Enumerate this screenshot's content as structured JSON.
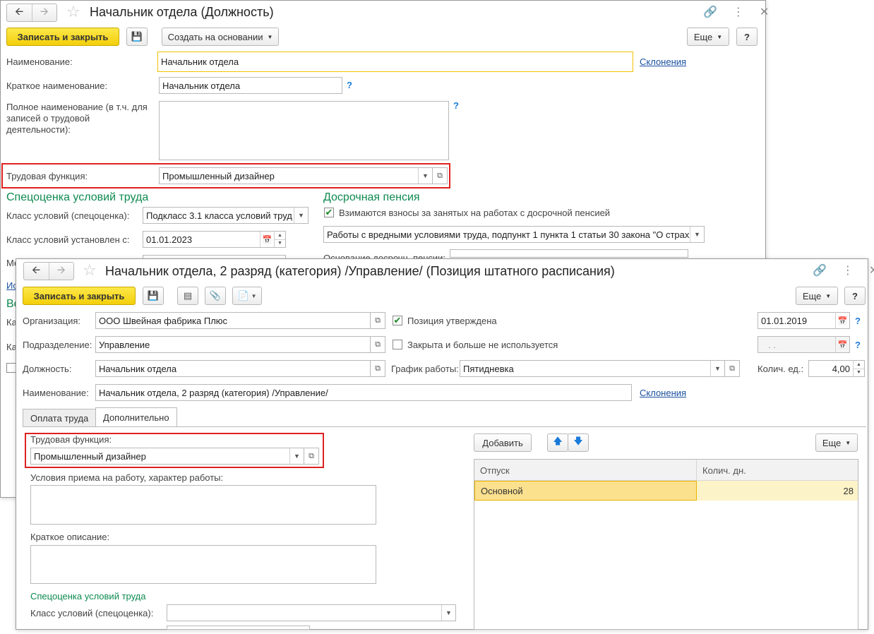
{
  "back_window": {
    "title": "Начальник отдела (Должность)",
    "toolbar": {
      "write_close": "Записать и закрыть",
      "create_based": "Создать на основании",
      "more": "Еще",
      "help": "?"
    },
    "name": {
      "label": "Наименование:",
      "value": "Начальник отдела",
      "declensions": "Склонения"
    },
    "short_name": {
      "label": "Краткое наименование:",
      "value": "Начальник отдела"
    },
    "full_name": {
      "label": "Полное наименование (в т.ч. для записей о трудовой деятельности):",
      "value": ""
    },
    "labor_function": {
      "label": "Трудовая функция:",
      "value": "Промышленный дизайнер"
    },
    "special_assessment": {
      "title": "Спецоценка условий труда",
      "class_label": "Класс условий (спецоценка):",
      "class_value": "Подкласс 3.1 класса условий труд",
      "set_from_label": "Класс условий установлен с:",
      "set_from_value": "01.01.2023",
      "partial_label": "Ме",
      "partial_link": "Ис",
      "partial_section": "Во",
      "partial_ka1": "Ка",
      "partial_ka2": "Ка"
    },
    "early_pension": {
      "title": "Досрочная пенсия",
      "checkbox_label": "Взимаются взносы за занятых на работах с досрочной пенсией",
      "checked": true,
      "work_value": "Работы с вредными условиями труда, подпункт 1 пункта 1 статьи 30 закона \"О страх",
      "basis_label": "Основание досрочн. пенсии:"
    }
  },
  "front_window": {
    "title": "Начальник отдела, 2 разряд (категория) /Управление/ (Позиция штатного расписания)",
    "toolbar": {
      "write_close": "Записать и закрыть",
      "more": "Еще",
      "help": "?"
    },
    "organization": {
      "label": "Организация:",
      "value": "ООО Швейная фабрика Плюс"
    },
    "department": {
      "label": "Подразделение:",
      "value": "Управление"
    },
    "position": {
      "label": "Должность:",
      "value": "Начальник отдела"
    },
    "name": {
      "label": "Наименование:",
      "value": "Начальник отдела, 2 разряд (категория) /Управление/",
      "declensions": "Склонения"
    },
    "approved": {
      "label": "Позиция утверждена",
      "checked": true,
      "date": "01.01.2019"
    },
    "closed": {
      "label": "Закрыта и больше не используется",
      "checked": false,
      "date": ". ."
    },
    "schedule": {
      "label": "График работы:",
      "value": "Пятидневка"
    },
    "units": {
      "label": "Колич. ед.:",
      "value": "4,00"
    },
    "tabs": [
      {
        "label": "Оплата труда"
      },
      {
        "label": "Дополнительно"
      }
    ],
    "extra": {
      "labor_function_label": "Трудовая функция:",
      "labor_function_value": "Промышленный дизайнер",
      "conditions_label": "Условия приема на работу, характер работы:",
      "description_label": "Краткое описание:",
      "section": "Спецоценка условий труда",
      "class_label": "Класс условий (спецоценка):"
    },
    "leave_table": {
      "add": "Добавить",
      "more": "Еще",
      "columns": [
        "Отпуск",
        "Колич. дн."
      ],
      "rows": [
        {
          "leave": "Основной",
          "days": "28"
        }
      ]
    }
  }
}
